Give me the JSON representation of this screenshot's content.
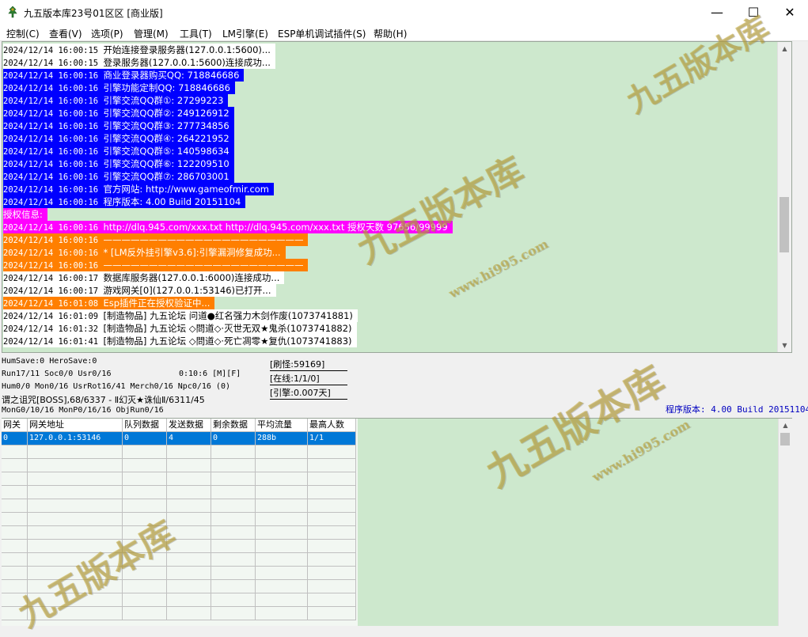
{
  "window": {
    "title": "九五版本库23号01区区 [商业版]",
    "minimize": "—",
    "maximize": "☐",
    "close": "✕"
  },
  "menu": [
    "控制(C)",
    "查看(V)",
    "选项(P)",
    "管理(M)",
    "工具(T)",
    "LM引擎(E)",
    "ESP单机调试插件(S)",
    "帮助(H)"
  ],
  "log": [
    {
      "time": "2024/12/14 16:00:15",
      "text": "开始连接登录服务器(127.0.0.1:5600)...",
      "color": "white"
    },
    {
      "time": "2024/12/14 16:00:15",
      "text": "登录服务器(127.0.0.1:5600)连接成功...",
      "color": "white"
    },
    {
      "time": "2024/12/14 16:00:16",
      "text": "商业登录器购买QQ: 718846686",
      "color": "blue"
    },
    {
      "time": "2024/12/14 16:00:16",
      "text": "引擎功能定制QQ: 718846686",
      "color": "blue"
    },
    {
      "time": "2024/12/14 16:00:16",
      "text": "引擎交流QQ群①: 27299223",
      "color": "blue"
    },
    {
      "time": "2024/12/14 16:00:16",
      "text": "引擎交流QQ群②: 249126912",
      "color": "blue"
    },
    {
      "time": "2024/12/14 16:00:16",
      "text": "引擎交流QQ群③: 277734856",
      "color": "blue"
    },
    {
      "time": "2024/12/14 16:00:16",
      "text": "引擎交流QQ群④: 264221952",
      "color": "blue"
    },
    {
      "time": "2024/12/14 16:00:16",
      "text": "引擎交流QQ群⑤: 140598634",
      "color": "blue"
    },
    {
      "time": "2024/12/14 16:00:16",
      "text": "引擎交流QQ群⑥: 122209510",
      "color": "blue"
    },
    {
      "time": "2024/12/14 16:00:16",
      "text": "引擎交流QQ群⑦: 286703001",
      "color": "blue"
    },
    {
      "time": "2024/12/14 16:00:16",
      "text": "官方网站: http://www.gameofmir.com",
      "color": "blue"
    },
    {
      "time": "2024/12/14 16:00:16",
      "text": "程序版本: 4.00 Build 20151104",
      "color": "blue"
    },
    {
      "time": "",
      "text": "授权信息:",
      "color": "magenta"
    },
    {
      "time": "2024/12/14 16:00:16",
      "text": "http://dlq.945.com/xxx.txt http://dlq.945.com/xxx.txt 授权天数 97656/99999",
      "color": "magenta"
    },
    {
      "time": "2024/12/14 16:00:16",
      "text": "——————————————————————",
      "color": "orange"
    },
    {
      "time": "2024/12/14 16:00:16",
      "text": "* [LM反外挂引擎v3.6]:引擎漏洞修复成功...",
      "color": "orange"
    },
    {
      "time": "2024/12/14 16:00:16",
      "text": "——————————————————————",
      "color": "orange"
    },
    {
      "time": "2024/12/14 16:00:17",
      "text": "数据库服务器(127.0.0.1:6000)连接成功...",
      "color": "white"
    },
    {
      "time": "2024/12/14 16:00:17",
      "text": "游戏网关[0](127.0.0.1:53146)已打开...",
      "color": "white"
    },
    {
      "time": "2024/12/14 16:01:08",
      "text": "Esp插件正在授权验证中...",
      "color": "orange"
    },
    {
      "time": "2024/12/14 16:01:09",
      "text": "[制造物品] 九五论坛 问道●红名强力木剑作废(1073741881)",
      "color": "white"
    },
    {
      "time": "2024/12/14 16:01:32",
      "text": "[制造物品] 九五论坛 ◇問道◇·灭世无双★鬼杀(1073741882)",
      "color": "white"
    },
    {
      "time": "2024/12/14 16:01:41",
      "text": "[制造物品] 九五论坛 ◇問道◇·死亡凋零★复仇(1073741883)",
      "color": "white"
    }
  ],
  "status": {
    "line1": "HumSave:0 HeroSave:0",
    "line2": "Run17/11 Soc0/0 Usr0/16",
    "timer": "0:10:6 [M][F]",
    "line3": "Hum0/0 Mon0/16 UsrRot16/41 Merch0/16 Npc0/16 (0)",
    "line4": "谓之诅咒[BOSS],68/6337 - Ⅱ幻灭★诛仙Ⅱ/6311/45",
    "line5": "MonG0/10/16 MonP0/16/16 ObjRun0/16",
    "refresh": "[刷怪:59169]",
    "online": "[在线:1/1/0]",
    "engine": "[引擎:0.007天]",
    "version": "程序版本: 4.00 Build 20151104"
  },
  "grid": {
    "headers": [
      "网关",
      "网关地址",
      "队列数据",
      "发送数据",
      "剩余数据",
      "平均流量",
      "最高人数"
    ],
    "rows": [
      [
        "0",
        "127.0.0.1:53146",
        "0",
        "4",
        "0",
        "288b",
        "1/1"
      ]
    ]
  },
  "watermark": {
    "text": "九五版本库",
    "url": "www.hi995.com"
  },
  "colors": {
    "log_bg": "#cde8cd",
    "blue": "#0000ff",
    "magenta": "#ff00ff",
    "orange": "#ff7f00",
    "selection": "#0078d7"
  }
}
